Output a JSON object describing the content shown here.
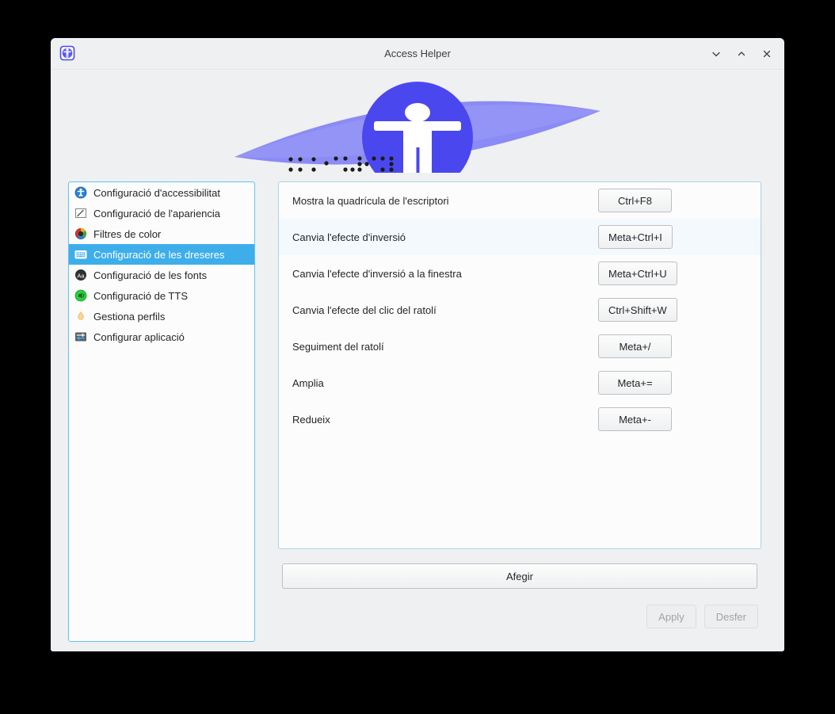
{
  "window": {
    "title": "Access Helper",
    "app_icon": "accessibility-person-icon",
    "controls": [
      {
        "name": "minimize",
        "glyph": "chevron-down-icon"
      },
      {
        "name": "maximize",
        "glyph": "chevron-up-icon"
      },
      {
        "name": "close",
        "glyph": "close-icon"
      }
    ]
  },
  "banner": {
    "icon": "accessibility-person-icon",
    "decoration": "braille-dots",
    "lens_color": "#8b8bf5",
    "circle_color": "#4b47ef"
  },
  "sidebar": {
    "items": [
      {
        "label": "Configuració d'accessibilitat",
        "icon": "accessibility-settings-icon",
        "selected": false
      },
      {
        "label": "Configuració de l'apariencia",
        "icon": "appearance-settings-icon",
        "selected": false
      },
      {
        "label": "Filtres de color",
        "icon": "color-filters-icon",
        "selected": false
      },
      {
        "label": "Configuració de les dreseres",
        "icon": "keyboard-shortcuts-icon",
        "selected": true
      },
      {
        "label": "Configuració de les fonts",
        "icon": "fonts-settings-icon",
        "selected": false
      },
      {
        "label": "Configuració de TTS",
        "icon": "tts-settings-icon",
        "selected": false
      },
      {
        "label": "Gestiona perfils",
        "icon": "profiles-icon",
        "selected": false
      },
      {
        "label": "Configurar aplicació",
        "icon": "configure-application-icon",
        "selected": false
      }
    ]
  },
  "shortcuts": {
    "rows": [
      {
        "label": "Mostra la quadrícula de l'escriptori",
        "key": "Ctrl+F8",
        "highlighted": false
      },
      {
        "label": "Canvia l'efecte d'inversió",
        "key": "Meta+Ctrl+I",
        "highlighted": true
      },
      {
        "label": "Canvia l'efecte d'inversió a la finestra",
        "key": "Meta+Ctrl+U",
        "highlighted": false
      },
      {
        "label": "Canvia l'efecte del clic del ratolí",
        "key": "Ctrl+Shift+W",
        "highlighted": false
      },
      {
        "label": "Seguiment del ratolí",
        "key": "Meta+/",
        "highlighted": false
      },
      {
        "label": "Amplia",
        "key": "Meta+=",
        "highlighted": false
      },
      {
        "label": "Redueix",
        "key": "Meta+-",
        "highlighted": false
      }
    ]
  },
  "actions": {
    "add_label": "Afegir",
    "apply_label": "Apply",
    "undo_label": "Desfer"
  },
  "colors": {
    "highlight": "#3daee9",
    "window_bg": "#eff0f1",
    "panel_bg": "#fcfcfc",
    "text": "#232629",
    "accent_violet": "#4b47ef"
  }
}
